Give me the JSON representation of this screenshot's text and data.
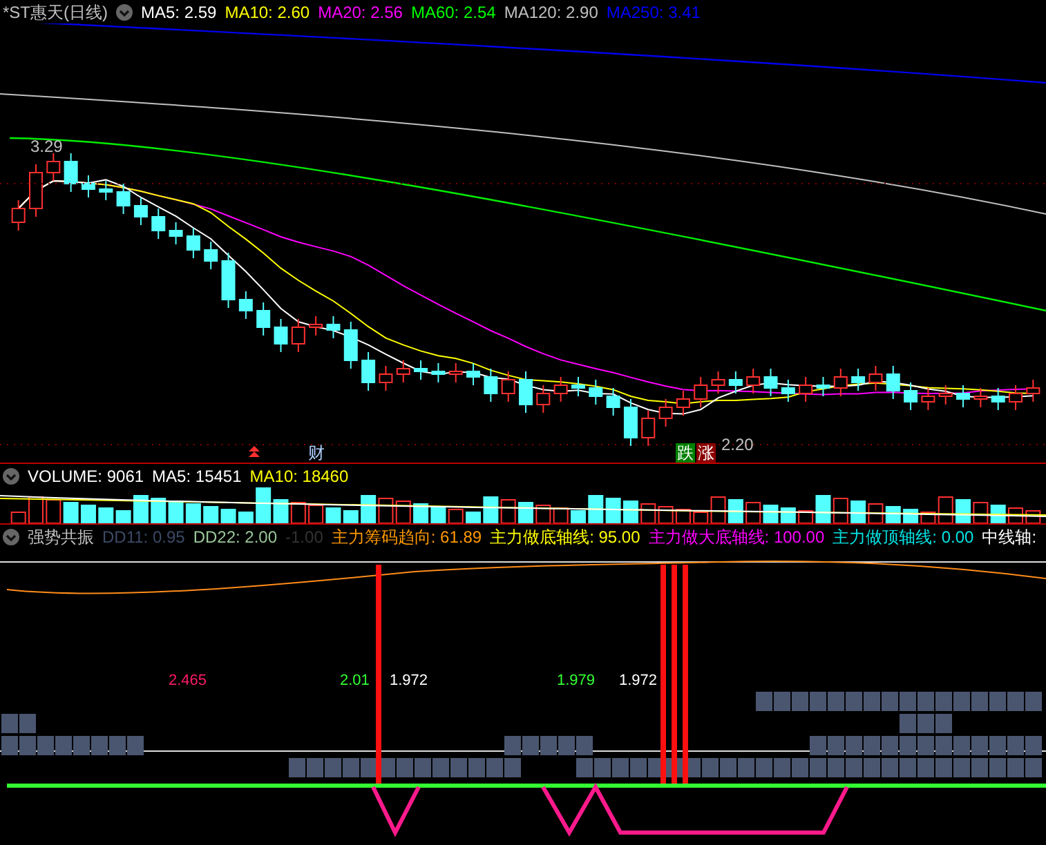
{
  "main": {
    "title": "*ST惠天(日线)",
    "legend": [
      {
        "text": "MA5: 2.59",
        "color": "#ffffff"
      },
      {
        "text": "MA10: 2.60",
        "color": "#ffff00"
      },
      {
        "text": "MA20: 2.56",
        "color": "#ff00ff"
      },
      {
        "text": "MA60: 2.54",
        "color": "#00ff00"
      },
      {
        "text": "MA120: 2.90",
        "color": "#c0c0c0"
      },
      {
        "text": "MA250: 3.41",
        "color": "#0000ff"
      }
    ],
    "high_label": "3.29",
    "low_label": "2.20",
    "markers": [
      {
        "text": "财",
        "kind": "news"
      },
      {
        "text": "跌",
        "kind": "down"
      },
      {
        "text": "涨",
        "kind": "up"
      }
    ]
  },
  "volume": {
    "legend": [
      {
        "text": "VOLUME: 9061",
        "color": "#ffffff"
      },
      {
        "text": "MA5: 15451",
        "color": "#ffffff"
      },
      {
        "text": "MA10: 18460",
        "color": "#ffff00"
      }
    ]
  },
  "indicator": {
    "title": "强势共振",
    "legend": [
      {
        "text": "DD11: 0.95",
        "color": "#3c4a66"
      },
      {
        "text": "DD22: 2.00",
        "color": "#9ac79a"
      },
      {
        "text": "-1.00",
        "color": "#333333"
      },
      {
        "text": "主力筹码趋向: 61.89",
        "color": "#ff9900"
      },
      {
        "text": "主力做底轴线: 95.00",
        "color": "#ffff00"
      },
      {
        "text": "主力做大底轴线: 100.00",
        "color": "#ff00ff"
      },
      {
        "text": "主力做顶轴线: 0.00",
        "color": "#00e5e5"
      },
      {
        "text": "中线轴:",
        "color": "#ffffff"
      }
    ],
    "value_labels": [
      {
        "text": "2.465",
        "color": "#ff1a66"
      },
      {
        "text": "2.01",
        "color": "#33ff33"
      },
      {
        "text": "1.972",
        "color": "#ffffff"
      },
      {
        "text": "1.979",
        "color": "#33ff33"
      },
      {
        "text": "1.972",
        "color": "#ffffff"
      }
    ]
  }
}
